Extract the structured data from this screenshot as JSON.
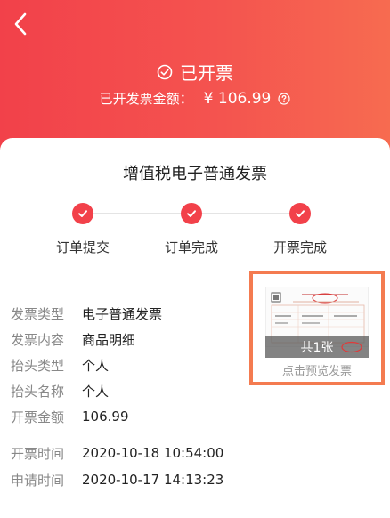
{
  "header": {
    "status_text": "已开票",
    "amount_label": "已开发票金额：",
    "amount_value": "¥ 106.99"
  },
  "invoice": {
    "title": "增值税电子普通发票",
    "steps": [
      {
        "label": "订单提交"
      },
      {
        "label": "订单完成"
      },
      {
        "label": "开票完成"
      }
    ],
    "details": [
      {
        "key": "发票类型",
        "value": "电子普通发票"
      },
      {
        "key": "发票内容",
        "value": "商品明细"
      },
      {
        "key": "抬头类型",
        "value": "个人"
      },
      {
        "key": "抬头名称",
        "value": "个人"
      },
      {
        "key": "开票金额",
        "value": "106.99"
      },
      {
        "key": "开票时间",
        "value": "2020-10-18 10:54:00"
      },
      {
        "key": "申请时间",
        "value": "2020-10-17 14:13:23"
      }
    ],
    "preview": {
      "count_text": "共1张",
      "caption": "点击预览发票"
    }
  },
  "colors": {
    "brand_red": "#f2414a",
    "highlight_border": "#f47b50"
  }
}
